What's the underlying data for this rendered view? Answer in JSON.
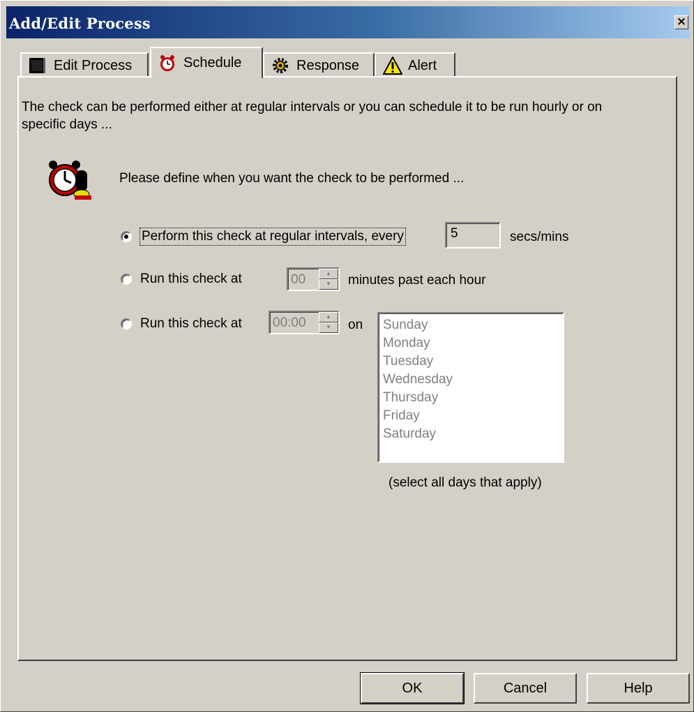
{
  "window": {
    "title": "Add/Edit Process",
    "close_glyph": "×"
  },
  "tabs": [
    {
      "label": "Edit Process",
      "icon": "edit-process-icon"
    },
    {
      "label": "Schedule",
      "icon": "alarm-clock-icon",
      "active": true
    },
    {
      "label": "Response",
      "icon": "gear-icon"
    },
    {
      "label": "Alert",
      "icon": "warning-icon"
    }
  ],
  "schedule": {
    "intro": "The check can be performed either at regular intervals or you can schedule it to be run hourly or on specific days ...",
    "prompt": "Please define when you want the check to be performed ...",
    "option_interval_label": "Perform this check at regular intervals, every",
    "interval_value": "5",
    "interval_units": "secs/mins",
    "option_hourly_label": "Run this check at",
    "hourly_minutes_value": "00",
    "hourly_suffix": "minutes past each hour",
    "option_daily_label": "Run this check at",
    "daily_time_value": "00:00",
    "daily_on": "on",
    "days": [
      "Sunday",
      "Monday",
      "Tuesday",
      "Wednesday",
      "Thursday",
      "Friday",
      "Saturday"
    ],
    "days_hint": "(select all days that apply)",
    "selected_option": "interval"
  },
  "buttons": {
    "ok": "OK",
    "cancel": "Cancel",
    "help": "Help"
  }
}
